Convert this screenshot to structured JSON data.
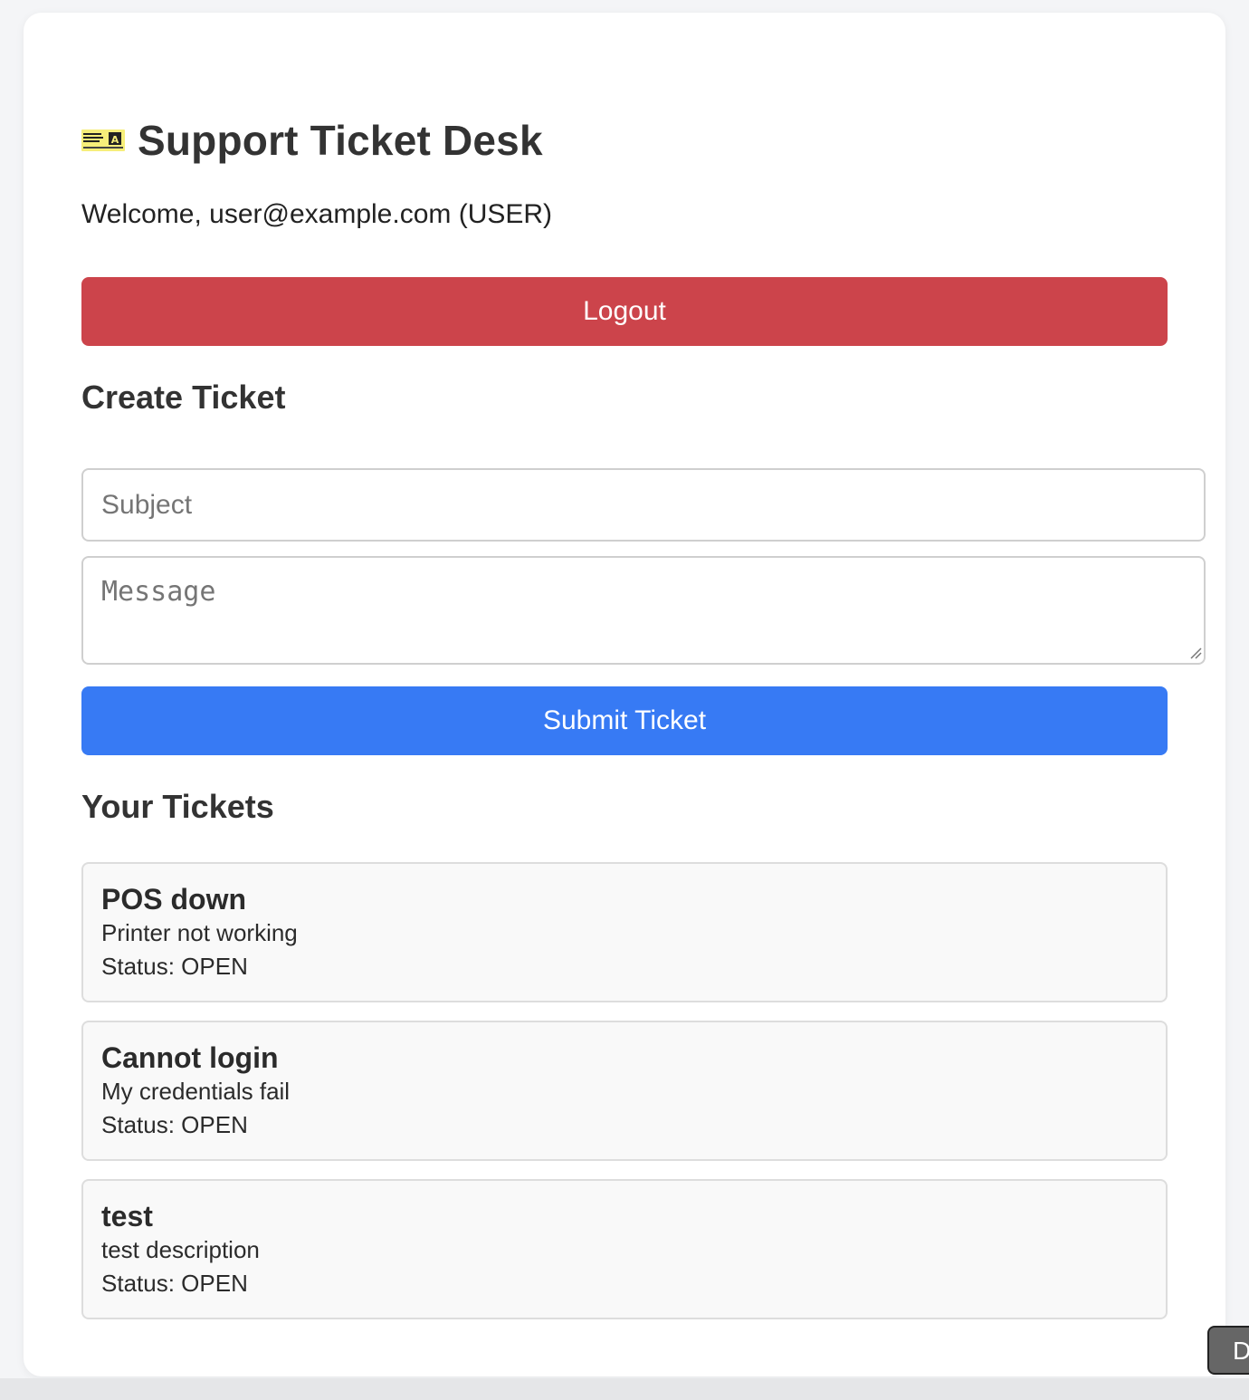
{
  "header": {
    "icon": "ticket-icon",
    "title": "Support Ticket Desk",
    "welcome": "Welcome, user@example.com (USER)"
  },
  "actions": {
    "logout_label": "Logout"
  },
  "create_ticket": {
    "heading": "Create Ticket",
    "subject_placeholder": "Subject",
    "subject_value": "",
    "message_placeholder": "Message",
    "message_value": "",
    "submit_label": "Submit Ticket"
  },
  "tickets": {
    "heading": "Your Tickets",
    "items": [
      {
        "subject": "POS down",
        "message": "Printer not working",
        "status": "Status: OPEN"
      },
      {
        "subject": "Cannot login",
        "message": "My credentials fail",
        "status": "Status: OPEN"
      },
      {
        "subject": "test",
        "message": "test description",
        "status": "Status: OPEN"
      }
    ]
  },
  "floating": {
    "dev_label": "D"
  },
  "colors": {
    "logout": "#cc444b",
    "submit": "#377af4",
    "text": "#333333",
    "ticket_bg": "#f9f9f9"
  }
}
